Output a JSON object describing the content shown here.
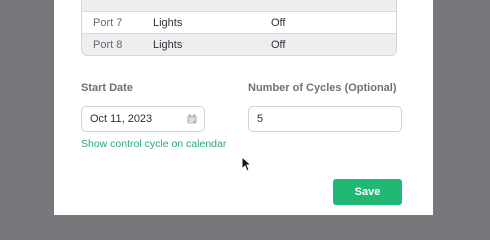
{
  "ports_table": {
    "partial_row": {
      "port": "",
      "type": "",
      "state": ""
    },
    "rows": [
      {
        "port": "Port 7",
        "type": "Lights",
        "state": "Off"
      },
      {
        "port": "Port 8",
        "type": "Lights",
        "state": "Off"
      }
    ]
  },
  "start_date": {
    "label": "Start Date",
    "value": "Oct 11, 2023",
    "icon": "calendar-icon"
  },
  "cycles": {
    "label": "Number of Cycles (Optional)",
    "value": "5"
  },
  "calendar_link": "Show control cycle on calendar",
  "save_label": "Save",
  "colors": {
    "accent": "#21b774",
    "link": "#2aa879",
    "overlay": "#76787b"
  }
}
